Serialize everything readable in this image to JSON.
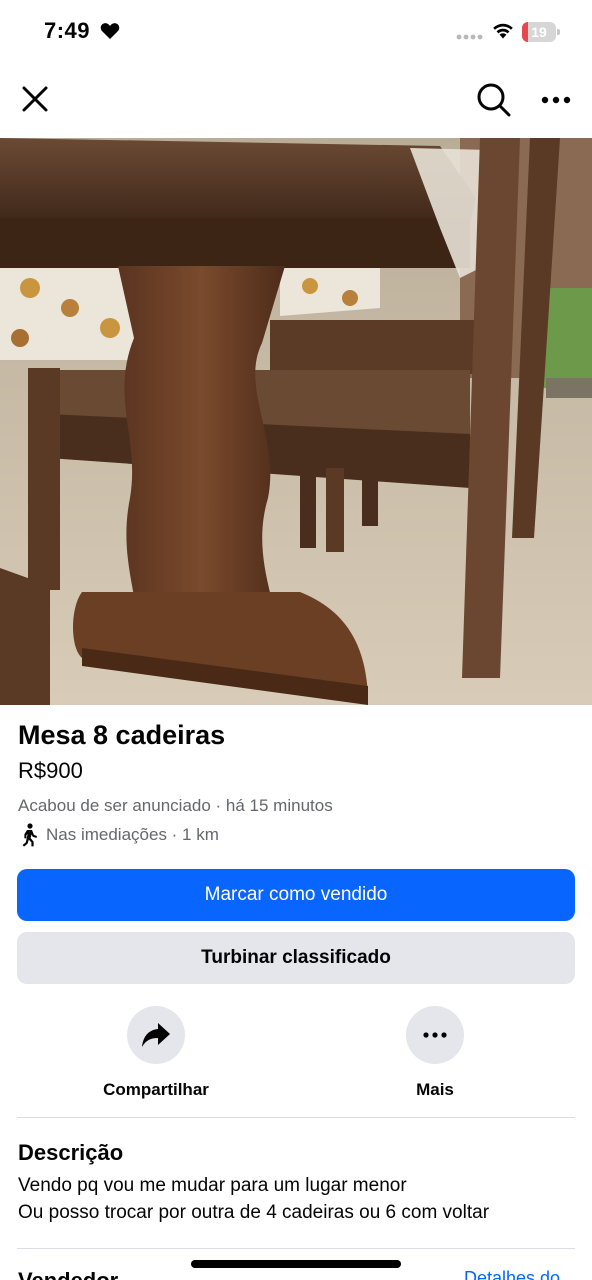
{
  "status_bar": {
    "time": "7:49",
    "battery_level": "19",
    "battery_fraction": 0.19,
    "battery_color": "#e5484d"
  },
  "nav": {
    "close_icon": "close-icon",
    "search_icon": "search-icon",
    "more_icon": "more-horizontal-icon"
  },
  "photo": {
    "description_icon": "listing-photo",
    "page_count": 3,
    "current_page": 1
  },
  "listing": {
    "title": "Mesa 8 cadeiras",
    "price": "R$900",
    "listed": "Acabou de ser anunciado",
    "time_ago": " · há 15 minutos",
    "location": "Nas imediações · 1 km"
  },
  "buttons": {
    "mark_sold": "Marcar como vendido",
    "boost": "Turbinar classificado"
  },
  "actions": {
    "share": "Compartilhar",
    "more": "Mais"
  },
  "description": {
    "heading": "Descrição",
    "line1": "Vendo pq vou me mudar para um lugar menor",
    "line2": "Ou posso trocar por outra de 4 cadeiras ou 6 com voltar"
  },
  "seller": {
    "heading": "Vendedor",
    "link": "Detalhes do"
  },
  "colors": {
    "primary": "#0866ff",
    "secondary_bg": "#e4e6eb",
    "muted_text": "#65676b"
  }
}
